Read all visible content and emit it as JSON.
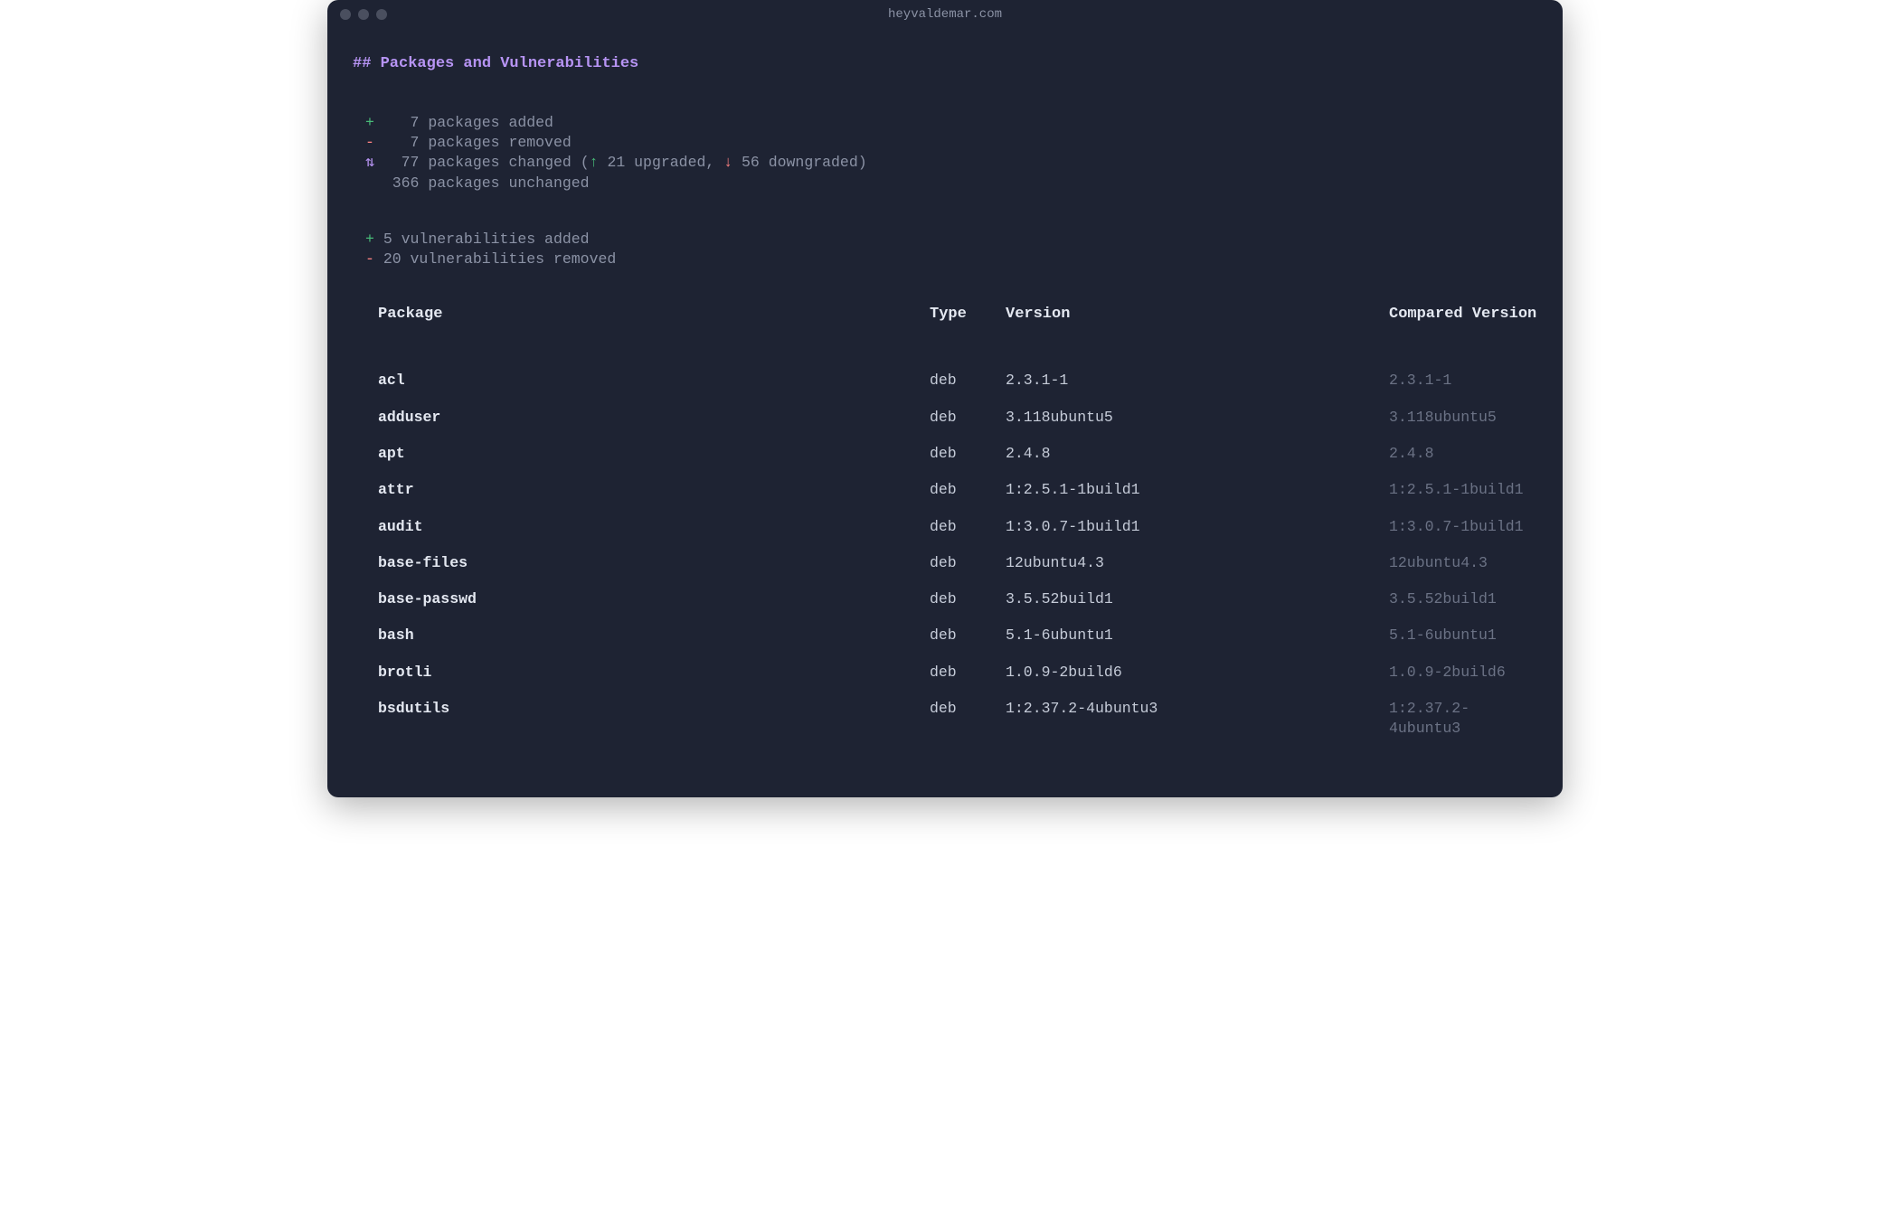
{
  "window": {
    "title": "heyvaldemar.com"
  },
  "heading": "## Packages and Vulnerabilities",
  "summary": {
    "added": {
      "symbol": "+",
      "count": "7",
      "label": "packages added"
    },
    "removed": {
      "symbol": "-",
      "count": "7",
      "label": "packages removed"
    },
    "changed": {
      "symbol": "⇅",
      "count": "77",
      "label": "packages changed",
      "open": "(",
      "up_sym": "↑",
      "up_count": "21",
      "up_label": "upgraded",
      "sep": ", ",
      "down_sym": "↓",
      "down_count": "56",
      "down_label": "downgraded",
      "close": ")"
    },
    "unchanged": {
      "symbol": " ",
      "count": "366",
      "label": "packages unchanged"
    }
  },
  "vulns": {
    "added": {
      "symbol": "+",
      "count": "5",
      "label": "vulnerabilities added"
    },
    "removed": {
      "symbol": "-",
      "count": "20",
      "label": "vulnerabilities removed"
    }
  },
  "table": {
    "headers": {
      "package": "Package",
      "type": "Type",
      "version": "Version",
      "compared": "Compared Version"
    },
    "rows": [
      {
        "package": "acl",
        "type": "deb",
        "version": "2.3.1-1",
        "compared": "2.3.1-1"
      },
      {
        "package": "adduser",
        "type": "deb",
        "version": "3.118ubuntu5",
        "compared": "3.118ubuntu5"
      },
      {
        "package": "apt",
        "type": "deb",
        "version": "2.4.8",
        "compared": "2.4.8"
      },
      {
        "package": "attr",
        "type": "deb",
        "version": "1:2.5.1-1build1",
        "compared": "1:2.5.1-1build1"
      },
      {
        "package": "audit",
        "type": "deb",
        "version": "1:3.0.7-1build1",
        "compared": "1:3.0.7-1build1"
      },
      {
        "package": "base-files",
        "type": "deb",
        "version": "12ubuntu4.3",
        "compared": "12ubuntu4.3"
      },
      {
        "package": "base-passwd",
        "type": "deb",
        "version": "3.5.52build1",
        "compared": "3.5.52build1"
      },
      {
        "package": "bash",
        "type": "deb",
        "version": "5.1-6ubuntu1",
        "compared": "5.1-6ubuntu1"
      },
      {
        "package": "brotli",
        "type": "deb",
        "version": "1.0.9-2build6",
        "compared": "1.0.9-2build6"
      },
      {
        "package": "bsdutils",
        "type": "deb",
        "version": "1:2.37.2-4ubuntu3",
        "compared": "1:2.37.2-4ubuntu3"
      }
    ]
  }
}
